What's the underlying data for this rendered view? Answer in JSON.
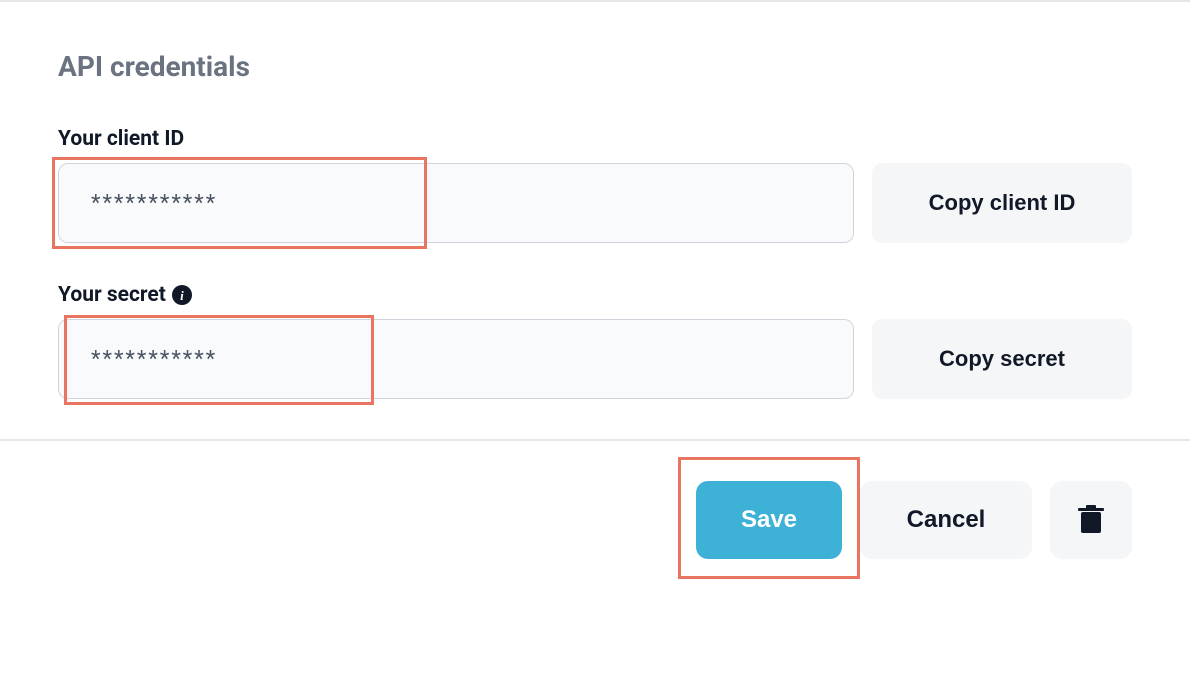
{
  "header": {
    "title": "API credentials"
  },
  "clientId": {
    "label": "Your client ID",
    "value": "***********",
    "copyLabel": "Copy client ID"
  },
  "secret": {
    "label": "Your secret",
    "value": "***********",
    "copyLabel": "Copy secret",
    "infoIcon": "i"
  },
  "actions": {
    "save": "Save",
    "cancel": "Cancel"
  },
  "colors": {
    "accent": "#3db1d6",
    "highlight": "#e9745f",
    "mutedBg": "#f5f6f8"
  }
}
